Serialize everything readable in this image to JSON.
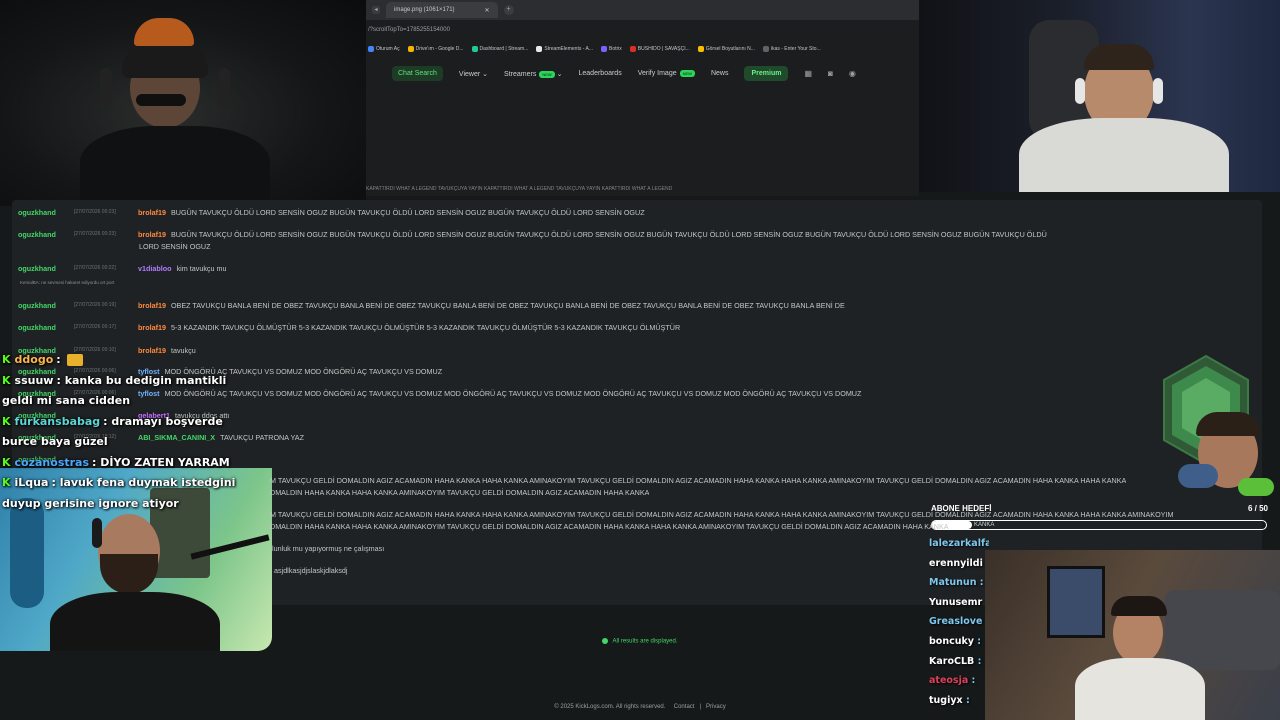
{
  "browser": {
    "tab_title": "image.png (1061×171)",
    "tab_close": "✕",
    "new_tab": "+",
    "address": "/?scrollTopTo=1785255154000",
    "bookmarks": [
      {
        "label": "Oturum Aç",
        "color": "#4285f4"
      },
      {
        "label": "Drive'ım - Google D...",
        "color": "#f4b400"
      },
      {
        "label": "Dashboard | Stream...",
        "color": "#20c997"
      },
      {
        "label": "StreamElements - A...",
        "color": "#e8e8e8"
      },
      {
        "label": "Botrix",
        "color": "#7b61ff"
      },
      {
        "label": "BUSHIDO | SAVAŞÇI...",
        "color": "#d93025"
      },
      {
        "label": "Görsel Boyutlarını N...",
        "color": "#fbbc04"
      },
      {
        "label": "ikas - Enter Your Sto...",
        "color": "#5f6368"
      }
    ]
  },
  "site_nav": {
    "chat_search": "Chat Search",
    "viewer": "Viewer",
    "streamers": "Streamers",
    "streamers_badge": "NEW",
    "leaderboards": "Leaderboards",
    "verify_image": "Verify Image",
    "verify_badge": "NEW",
    "news": "News",
    "premium": "Premium",
    "icons": [
      "chart-icon",
      "discord-icon",
      "user-icon"
    ]
  },
  "scroll_text": "KAPATTIRDI WHAT A LEGEND TAVUKÇUYA YAYIN KAPATTIRDI WHAT A LEGEND TAVUKÇUYA YAYIN KAPATTIRDI WHAT A LEGEND",
  "messages": [
    {
      "user": "oguzkhand",
      "time": "[27/07/2026 00:23]",
      "sender": "brolaf19",
      "sender_color": "#ff8a3d",
      "text": "BUGÜN TAVUKÇU ÖLDÜ LORD SENSİN OGUZ BUGÜN TAVUKÇU ÖLDÜ LORD SENSİN OGUZ BUGÜN TAVUKÇU ÖLDÜ LORD SENSİN OGUZ"
    },
    {
      "user": "oguzkhand",
      "time": "[27/07/2026 00:23]",
      "sender": "brolaf19",
      "sender_color": "#ff8a3d",
      "text": "BUGÜN TAVUKÇU ÖLDÜ LORD SENSİN OGUZ BUGÜN TAVUKÇU ÖLDÜ LORD SENSİN OGUZ BUGÜN TAVUKÇU ÖLDÜ LORD SENSİN OGUZ BUGÜN TAVUKÇU ÖLDÜ LORD SENSİN OGUZ BUGÜN TAVUKÇU ÖLDÜ LORD SENSİN OGUZ BUGÜN TAVUKÇU ÖLDÜ",
      "wrap": "LORD SENSİN OGUZ"
    },
    {
      "user": "oguzkhand",
      "time": "[27/07/2026 00:22]",
      "sender": "v1diabloo",
      "sender_color": "#b07cff",
      "text": "kim tavukçu mu",
      "reply": "KemalBA: ne sevmesi hakaret ediyordu ort port"
    },
    {
      "user": "oguzkhand",
      "time": "[27/07/2026 00:19]",
      "sender": "brolaf19",
      "sender_color": "#ff8a3d",
      "text": "OBEZ TAVUKÇU BANLA BENİ DE OBEZ TAVUKÇU BANLA BENİ DE OBEZ TAVUKÇU BANLA BENİ DE OBEZ TAVUKÇU BANLA BENİ DE OBEZ TAVUKÇU BANLA BENİ DE OBEZ TAVUKÇU BANLA BENİ DE"
    },
    {
      "user": "oguzkhand",
      "time": "[27/07/2026 00:17]",
      "sender": "brolaf19",
      "sender_color": "#ff8a3d",
      "text": "5-3 KAZANDIK TAVUKÇU ÖLMÜŞTÜR 5-3 KAZANDIK TAVUKÇU ÖLMÜŞTÜR 5-3 KAZANDIK TAVUKÇU ÖLMÜŞTÜR 5-3 KAZANDIK TAVUKÇU ÖLMÜŞTÜR"
    },
    {
      "user": "oguzkhand",
      "time": "[27/07/2026 00:10]",
      "sender": "brolaf19",
      "sender_color": "#ff8a3d",
      "text": "tavukçu"
    },
    {
      "user": "oguzkhand",
      "time": "[27/07/2026 00:06]",
      "sender": "tyflost",
      "sender_color": "#6fb2ff",
      "text": "MOD ÖNGÖRÜ AÇ TAVUKÇU VS DOMUZ MOD ÖNGÖRÜ AÇ TAVUKÇU VS DOMUZ"
    },
    {
      "user": "oguzkhand",
      "time": "[27/07/2026 00:06]",
      "sender": "tyflost",
      "sender_color": "#6fb2ff",
      "text": "MOD ÖNGÖRÜ AÇ TAVUKÇU VS DOMUZ MOD ÖNGÖRÜ AÇ TAVUKÇU VS DOMUZ MOD ÖNGÖRÜ AÇ TAVUKÇU VS DOMUZ MOD ÖNGÖRÜ AÇ TAVUKÇU VS DOMUZ MOD ÖNGÖRÜ AÇ TAVUKÇU VS DOMUZ"
    },
    {
      "user": "oguzkhand",
      "time": "",
      "sender": "gelabert1",
      "sender_color": "#c86cff",
      "text": "tavukçu ddos attı"
    },
    {
      "user": "oguzkhand",
      "time": "[27/07/2026 18:12]",
      "sender": "ABI_SIKMA_CANINI_X",
      "sender_color": "#43d668",
      "text": "TAVUKÇU PATRONA YAZ"
    },
    {
      "user": "oguzkhand",
      "time": "",
      "sender": "",
      "sender_color": "#43d668",
      "text": ""
    }
  ],
  "wrapped_lines": [
    "M TAVUKÇU GELDİ DOMALDIN AGIZ ACAMADIN HAHA KANKA HAHA KANKA AMINAKOYIM TAVUKÇU GELDİ DOMALDIN AGIZ ACAMADIN HAHA KANKA HAHA KANKA AMINAKOYIM TAVUKÇU GELDİ DOMALDIN AGIZ ACAMADIN HAHA KANKA HAHA KANKA",
    "DMALDIN HAHA KANKA HAHA KANKA AMINAKOYIM TAVUKÇU GELDİ DOMALDIN AGIZ ACAMADIN HAHA KANKA",
    "M TAVUKÇU GELDİ DOMALDIN AGIZ ACAMADIN HAHA KANKA HAHA KANKA AMINAKOYIM TAVUKÇU GELDİ DOMALDIN AGIZ ACAMADIN HAHA KANKA HAHA KANKA AMINAKOYIM TAVUKÇU GELDİ DOMALDIN AGIZ ACAMADIN HAHA KANKA HAHA KANKA AMINAKOYIM",
    "DMALDIN HAHA KANKA HAHA KANKA AMINAKOYIM TAVUKÇU GELDİ DOMALDIN AGIZ ACAMADIN HAHA KANKA HAHA KANKA AMINAKOYIM TAVUKÇU GELDİ DOMALDIN AGIZ ACAMADIN HAHA KANKA",
    "lunluk mu yapıyormuş ne çalışması",
    "asjdlkasjdjslaskjdlaksdj"
  ],
  "all_results": "All results are displayed.",
  "footer": {
    "copyright": "© 2025 KickLogs.com. All rights reserved.",
    "contact": "Contact",
    "separator": "|",
    "privacy": "Privacy"
  },
  "overlay_chat": [
    {
      "name": "ddogo",
      "name_color": "#ffb64d",
      "text": ""
    },
    {
      "name": "ssuuw",
      "name_color": "#ffffff",
      "text": "kanka bu dedigin mantikli"
    },
    {
      "name": "",
      "name_color": "#ffffff",
      "text": "geldi mi sana cidden"
    },
    {
      "name": "furkansbabag",
      "name_color": "#5cd6d6",
      "text": "dramayı boşverde"
    },
    {
      "name": "",
      "name_color": "#ffffff",
      "text": "burce baya güzel"
    },
    {
      "name": "cozanostras",
      "name_color": "#4aa8ff",
      "text": "DİYO ZATEN YARRAM"
    },
    {
      "name": "iLqua",
      "name_color": "#ffffff",
      "text": "lavuk fena duymak istedgini"
    },
    {
      "name": "",
      "name_color": "#ffffff",
      "text": "duyup gerisine ignore atiyor"
    }
  ],
  "sub_goal": {
    "label": "ABONE HEDEFİ",
    "count": "6 / 50",
    "progress": 0.12,
    "inner_text": "KANKA"
  },
  "chat_right": [
    {
      "name": "lalezarkalfa",
      "color": "#7ec8f0",
      "emote": true
    },
    {
      "name": "erennyildi",
      "color": "#ffffff",
      "emote": false
    },
    {
      "name": "Matunun",
      "color": "#7ec8f0",
      "emote": false
    },
    {
      "name": "Yunusemr",
      "color": "#ffffff",
      "emote": false
    },
    {
      "name": "Greaslove",
      "color": "#7ec8f0",
      "emote": false
    },
    {
      "name": "boncuky",
      "color": "#ffffff",
      "emote": false
    },
    {
      "name": "KaroCLB",
      "color": "#ffffff",
      "emote": false
    },
    {
      "name": "ateosja",
      "color": "#e0405a",
      "emote": false
    },
    {
      "name": "tugiyx",
      "color": "#ffffff",
      "emote": false
    }
  ],
  "colors": {
    "accent": "#43d668",
    "kick_green": "#53fc18"
  }
}
